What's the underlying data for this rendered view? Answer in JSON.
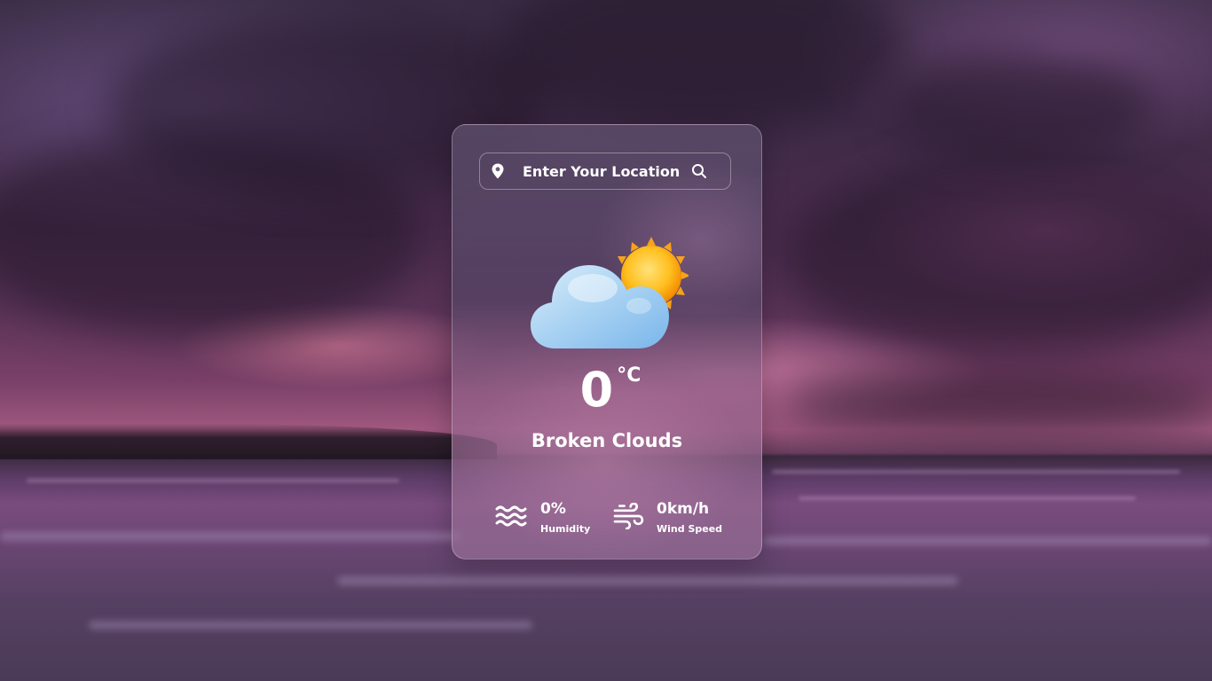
{
  "search": {
    "placeholder": "Enter Your Location",
    "pin_icon": "map-pin-icon",
    "button_icon": "search-icon"
  },
  "weather": {
    "icon": "partly-cloudy-sun-icon",
    "temperature": "0",
    "unit": "°C",
    "description": "Broken Clouds"
  },
  "details": {
    "humidity": {
      "icon": "waves-icon",
      "value": "0%",
      "label": "Humidity"
    },
    "wind": {
      "icon": "wind-icon",
      "value": "0km/h",
      "label": "Wind Speed"
    }
  },
  "colors": {
    "text": "#ffffff",
    "card_border": "rgba(255,255,255,0.28)",
    "sky": "#4a2d4e",
    "sunset_glow": "#a0587f"
  }
}
